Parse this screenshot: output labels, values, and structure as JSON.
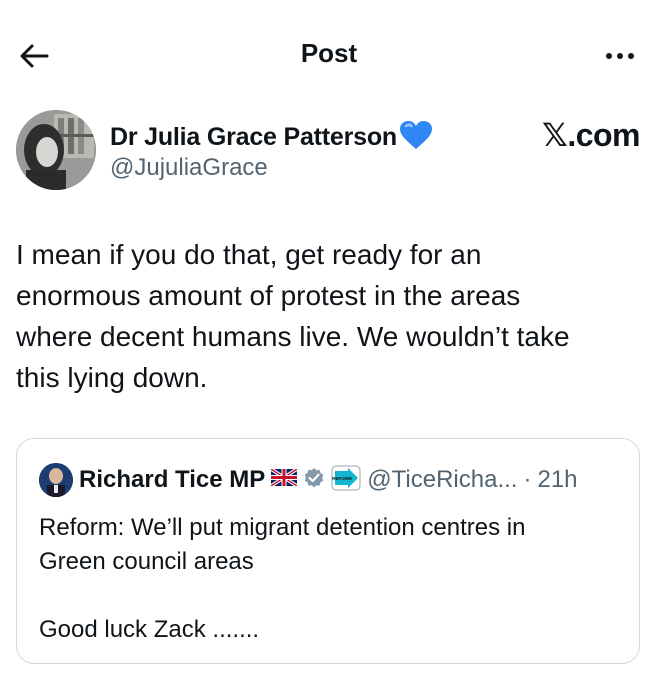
{
  "header": {
    "title": "Post",
    "back_icon": "arrow-left-icon",
    "more_icon": "more-horizontal-icon"
  },
  "post": {
    "author_name": "Dr Julia Grace Patterson",
    "author_emoji": "💙",
    "author_handle": "@JujuliaGrace",
    "brand": "𝕏.com",
    "text": "I mean if you do that, get ready for an\nenormous amount of protest in the areas\nwhere decent humans live. We wouldn’t take\nthis lying down."
  },
  "quoted_post": {
    "author_name": "Richard Tice MP",
    "flag_icon": "uk-flag-icon",
    "verified_icon": "verified-badge-icon",
    "affiliate_icon": "reform-affiliate-icon",
    "affiliate_text": "REFORM",
    "handle": "@TiceRicha...",
    "separator": "·",
    "time": "21h",
    "text": "Reform: We’ll put migrant detention centres in\nGreen council areas\n\nGood luck Zack ......."
  },
  "colors": {
    "text": "#0f1419",
    "secondary": "#536471",
    "border": "#cfd9de",
    "verified": "#829aab",
    "reform": "#12b6cf"
  }
}
